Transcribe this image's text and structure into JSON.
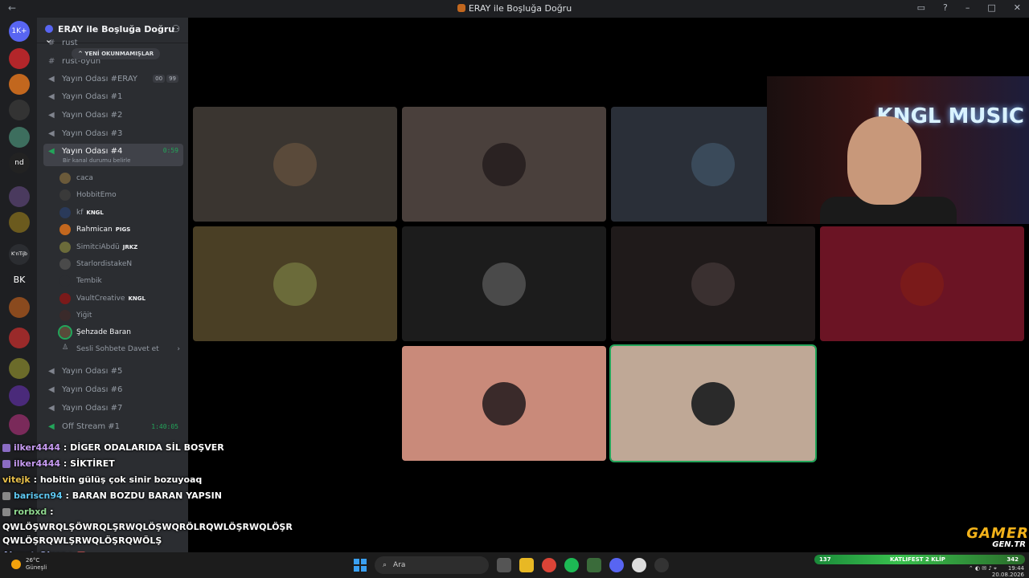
{
  "window": {
    "title": "ERAY ile Boşluğa Doğru"
  },
  "server": {
    "name": "ERAY ile Boşluğa Doğru",
    "unread_pill": "YENİ OKUNMAMIŞLAR"
  },
  "guilds": [
    {
      "label": "1K+"
    },
    {
      "label": ""
    },
    {
      "label": ""
    },
    {
      "label": ""
    },
    {
      "label": ""
    },
    {
      "label": "nd"
    },
    {
      "label": ""
    },
    {
      "label": ""
    },
    {
      "label": "K'nTijb"
    },
    {
      "label": "BK"
    },
    {
      "label": ""
    },
    {
      "label": ""
    },
    {
      "label": ""
    },
    {
      "label": ""
    },
    {
      "label": ""
    }
  ],
  "channels": {
    "top_partial": [
      "rust",
      "rust-oyun"
    ],
    "list": [
      {
        "name": "Yayın Odası #ERAY",
        "badges": [
          "00",
          "99"
        ]
      },
      {
        "name": "Yayın Odası #1"
      },
      {
        "name": "Yayın Odası #2"
      },
      {
        "name": "Yayın Odası #3"
      }
    ],
    "active": {
      "name": "Yayın Odası #4",
      "timer": "0:59",
      "status": "Bir kanal durumu belirle"
    },
    "members": [
      {
        "name": "caca",
        "tag": ""
      },
      {
        "name": "HobbitEmo",
        "tag": ""
      },
      {
        "name": "kf",
        "tag": "KNGL"
      },
      {
        "name": "Rahmican",
        "tag": "PIGS"
      },
      {
        "name": "SimitciAbdü",
        "tag": "JRKZ"
      },
      {
        "name": "StarlordistakeN",
        "tag": ""
      },
      {
        "name": "Tembik",
        "tag": ""
      },
      {
        "name": "VaultCreative",
        "tag": "KNGL"
      },
      {
        "name": "Yiğit",
        "tag": ""
      },
      {
        "name": "Şehzade Baran",
        "tag": ""
      }
    ],
    "invite": "Sesli Sohbete Davet et",
    "after": [
      {
        "name": "Yayın Odası #5"
      },
      {
        "name": "Yayın Odası #6"
      },
      {
        "name": "Yayın Odası #7"
      },
      {
        "name": "Off Stream #1",
        "timer": "1:40:05"
      }
    ]
  },
  "overlay_cam": {
    "neon_text": "KNGL MUSIC"
  },
  "chat": [
    {
      "user": "ilker4444",
      "message": "DİGER ODALARIDA SİL BOŞVER"
    },
    {
      "user": "ilker4444",
      "message": "SİKTİRET"
    },
    {
      "user": "vitejk",
      "message": "hobitin gülüş çok sinir bozuyoaq"
    },
    {
      "user": "bariscn94",
      "message": "BARAN BOZDU BARAN YAPSIN"
    },
    {
      "user": "rorbxd",
      "message": "QWLÖŞWRQLŞÖWRQLŞRWQLÖŞWQRÖLRQWLÖŞRWQLÖŞR QWLÖŞRQWLŞRWQLÖŞRQWÖLŞ"
    },
    {
      "user": "Ahmet_Olcer",
      "message": ""
    }
  ],
  "branding": {
    "line1": "GAMER",
    "line2": "GEN.TR"
  },
  "taskbar": {
    "weather_temp": "26°C",
    "weather_desc": "Güneşli",
    "search_placeholder": "Ara",
    "ticker_count": "137",
    "ticker_text": "KATLIFEST 2 KLİP",
    "ticker_right": "342",
    "time": "19:44",
    "date": "20.08.2026"
  },
  "colors": {
    "accent_green": "#23a55a",
    "sidebar": "#2b2d31",
    "guild_bar": "#1e1f22"
  }
}
